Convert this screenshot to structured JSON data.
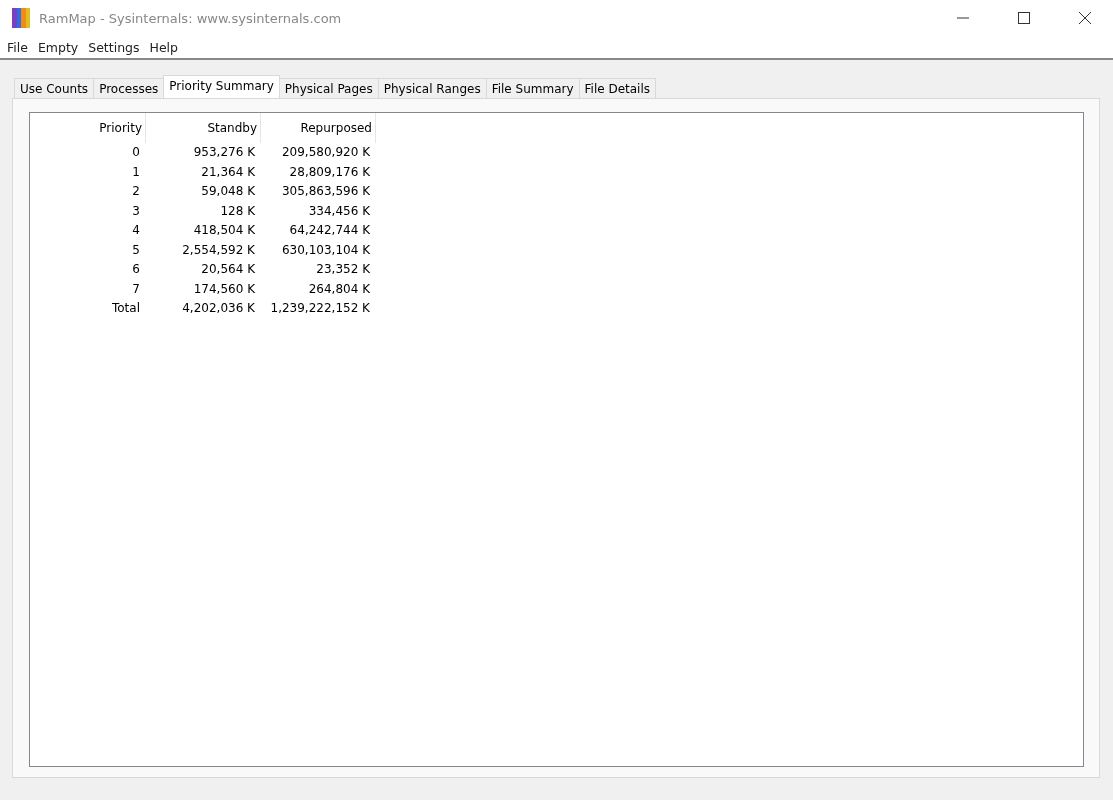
{
  "window": {
    "title": "RamMap - Sysinternals: www.sysinternals.com"
  },
  "menu": [
    "File",
    "Empty",
    "Settings",
    "Help"
  ],
  "tabs": [
    {
      "label": "Use Counts",
      "selected": false
    },
    {
      "label": "Processes",
      "selected": false
    },
    {
      "label": "Priority Summary",
      "selected": true
    },
    {
      "label": "Physical Pages",
      "selected": false
    },
    {
      "label": "Physical Ranges",
      "selected": false
    },
    {
      "label": "File Summary",
      "selected": false
    },
    {
      "label": "File Details",
      "selected": false
    }
  ],
  "table": {
    "columns": [
      "Priority",
      "Standby",
      "Repurposed"
    ],
    "rows": [
      [
        "0",
        "953,276 K",
        "209,580,920 K"
      ],
      [
        "1",
        "21,364 K",
        "28,809,176 K"
      ],
      [
        "2",
        "59,048 K",
        "305,863,596 K"
      ],
      [
        "3",
        "128 K",
        "334,456 K"
      ],
      [
        "4",
        "418,504 K",
        "64,242,744 K"
      ],
      [
        "5",
        "2,554,592 K",
        "630,103,104 K"
      ],
      [
        "6",
        "20,564 K",
        "23,352 K"
      ],
      [
        "7",
        "174,560 K",
        "264,804 K"
      ],
      [
        "Total",
        "4,202,036 K",
        "1,239,222,152 K"
      ]
    ]
  }
}
